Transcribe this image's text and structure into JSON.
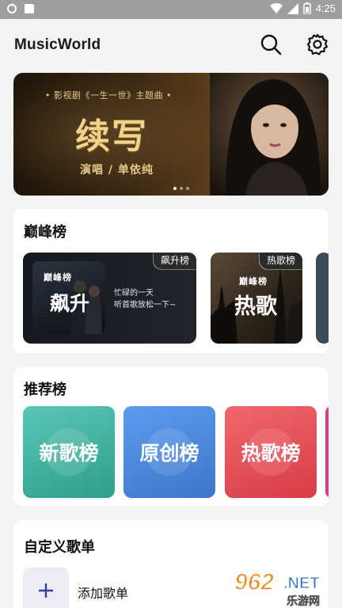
{
  "status_bar": {
    "time": "4:25"
  },
  "app": {
    "title": "MusicWorld"
  },
  "banner": {
    "subtitle": "• 影视剧《一生一世》主题曲 •",
    "main_title": "续写",
    "credit": "演唱 / 单依纯",
    "page_count": 3,
    "active_page": 1
  },
  "peak_section": {
    "title": "巅峰榜",
    "cards": [
      {
        "badge": "飙升榜",
        "logo": "巅峰榜",
        "name": "飙升",
        "desc_line1": "忙碌的一天",
        "desc_line2": "听首歌放松一下~"
      },
      {
        "badge": "热歌榜",
        "logo": "巅峰榜",
        "name": "热歌"
      }
    ]
  },
  "recommend_section": {
    "title": "推荐榜",
    "tiles": [
      {
        "label": "新歌榜",
        "color": "#3fb3a0"
      },
      {
        "label": "原创榜",
        "color": "#4a86dc"
      },
      {
        "label": "热歌榜",
        "color": "#e5474e"
      }
    ]
  },
  "custom_section": {
    "title": "自定义歌单",
    "add_label": "添加歌单"
  },
  "watermark": {
    "number": "962",
    "suffix": ".NET",
    "name": "乐游网"
  }
}
